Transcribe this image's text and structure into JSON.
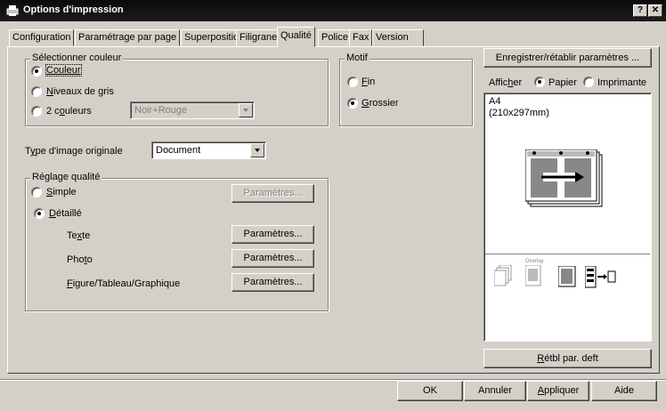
{
  "window": {
    "title": "Options d'impression",
    "help_btn": "?",
    "close_btn": "✕"
  },
  "tabs": [
    {
      "label": "Configuration"
    },
    {
      "label": "Paramétrage par page"
    },
    {
      "label": "Superposition"
    },
    {
      "label": "Filigrane"
    },
    {
      "label": "Qualité"
    },
    {
      "label": "Police"
    },
    {
      "label": "Fax"
    },
    {
      "label": "Version"
    }
  ],
  "color_group": {
    "legend": "Sélectionner couleur",
    "couleur": "Couleur",
    "gris_prefix": "N",
    "gris_rest": "iveaux de gris",
    "deux_prefix": "2 c",
    "deux_u": "o",
    "deux_rest": "uleurs",
    "deux_select": "Noir+Rouge"
  },
  "motif_group": {
    "legend": "Motif",
    "fin_prefix": "F",
    "fin_rest": "in",
    "grossier_prefix": "G",
    "grossier_rest": "rossier"
  },
  "image_type": {
    "label_prefix": "T",
    "label_u": "y",
    "label_rest": "pe d'image originale",
    "value": "Document"
  },
  "quality_group": {
    "legend": "Réglage qualité",
    "simple_prefix": "S",
    "simple_rest": "imple",
    "detaille_prefix": "D",
    "detaille_rest": "étaillé",
    "texte_a": "Te",
    "texte_u": "x",
    "texte_b": "te",
    "photo_a": "Pho",
    "photo_u": "t",
    "photo_b": "o",
    "figure_u": "F",
    "figure_rest": "igure/Tableau/Graphique",
    "params_disabled": "Paramètres...",
    "params_texte": "Paramètres...",
    "params_photo": "Paramètres...",
    "params_figure": "Paramètres..."
  },
  "right_panel": {
    "save_btn": "Enregistrer/rétablir paramètres ...",
    "afficher_a": "Affic",
    "afficher_u": "h",
    "afficher_b": "er",
    "papier": "Papier",
    "imprimante": "Imprimante",
    "paper_size": "A4",
    "paper_dims": "(210x297mm)",
    "overlay_label": "Overlay",
    "reset_u": "R",
    "reset_rest": "étbl par. deft"
  },
  "footer": {
    "ok": "OK",
    "annuler": "Annuler",
    "appliquer_u": "A",
    "appliquer_rest": "ppliquer",
    "aide": "Aide"
  }
}
